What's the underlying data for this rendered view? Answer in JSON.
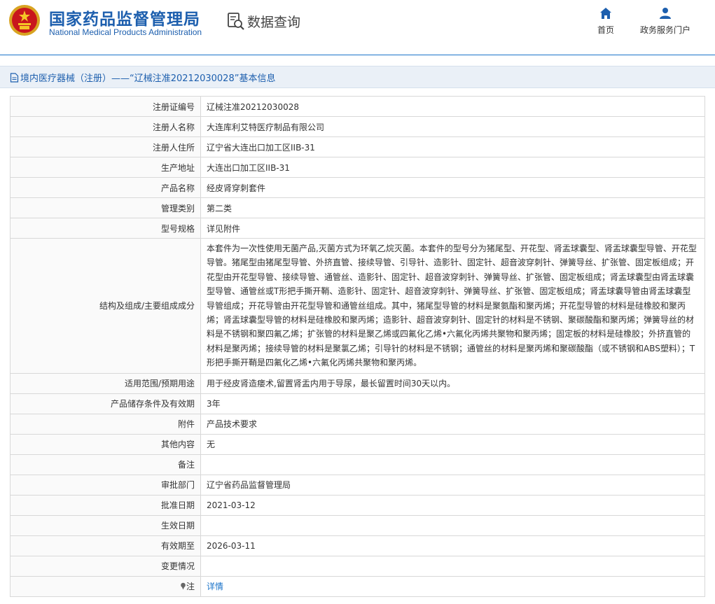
{
  "header": {
    "brand_cn": "国家药品监督管理局",
    "brand_en": "National Medical Products Administration",
    "section_title": "数据查询",
    "nav": [
      {
        "label": "首页",
        "icon": "home-icon"
      },
      {
        "label": "政务服务门户",
        "icon": "user-icon"
      }
    ]
  },
  "breadcrumb": {
    "text": "境内医疗器械（注册）——“辽械注准20212030028”基本信息"
  },
  "rows": [
    {
      "label": "注册证编号",
      "value": "辽械注准20212030028"
    },
    {
      "label": "注册人名称",
      "value": "大连库利艾特医疗制品有限公司"
    },
    {
      "label": "注册人住所",
      "value": "辽宁省大连出口加工区IIB-31"
    },
    {
      "label": "生产地址",
      "value": "大连出口加工区IIB-31"
    },
    {
      "label": "产品名称",
      "value": "经皮肾穿刺套件"
    },
    {
      "label": "管理类别",
      "value": "第二类"
    },
    {
      "label": "型号规格",
      "value": "详见附件"
    },
    {
      "label": "结构及组成/主要组成成分",
      "value": "本套件为一次性使用无菌产品,灭菌方式为环氧乙烷灭菌。本套件的型号分为猪尾型、开花型、肾盂球囊型、肾盂球囊型导管、开花型导管。猪尾型由猪尾型导管、外挤直管、接续导管、引导针、造影针、固定针、超音波穿刺针、弹簧导丝、扩张管、固定板组成；开花型由开花型导管、接续导管、通管丝、造影针、固定针、超音波穿刺针、弹簧导丝、扩张管、固定板组成；肾盂球囊型由肾盂球囊型导管、通管丝或T形把手撕开鞘、造影针、固定针、超音波穿刺针、弹簧导丝、扩张管、固定板组成；肾盂球囊导管由肾盂球囊型导管组成；开花导管由开花型导管和通管丝组成。其中，猪尾型导管的材料是聚氨酯和聚丙烯；开花型导管的材料是硅橡胶和聚丙烯；肾盂球囊型导管的材料是硅橡胶和聚丙烯；造影针、超音波穿刺针、固定针的材料是不锈钢、聚碳酸酯和聚丙烯；弹簧导丝的材料是不锈钢和聚四氟乙烯；扩张管的材料是聚乙烯或四氟化乙烯•六氟化丙烯共聚物和聚丙烯；固定板的材料是硅橡胶；外挤直管的材料是聚丙烯；接续导管的材料是聚氯乙烯；引导针的材料是不锈钢；通管丝的材料是聚丙烯和聚碳酸酯（或不锈钢和ABS塑料）；T形把手撕开鞘是四氟化乙烯•六氟化丙烯共聚物和聚丙烯。"
    },
    {
      "label": "适用范围/预期用途",
      "value": "用于经皮肾造瘘术,留置肾盂内用于导尿，最长留置时间30天以内。"
    },
    {
      "label": "产品储存条件及有效期",
      "value": "3年"
    },
    {
      "label": "附件",
      "value": "产品技术要求"
    },
    {
      "label": "其他内容",
      "value": "无"
    },
    {
      "label": "备注",
      "value": ""
    },
    {
      "label": "审批部门",
      "value": "辽宁省药品监督管理局"
    },
    {
      "label": "批准日期",
      "value": "2021-03-12"
    },
    {
      "label": "生效日期",
      "value": ""
    },
    {
      "label": "有效期至",
      "value": "2026-03-11"
    },
    {
      "label": "变更情况",
      "value": ""
    }
  ],
  "note_row": {
    "label": "注",
    "value": "详情",
    "icon": "pin-icon"
  }
}
